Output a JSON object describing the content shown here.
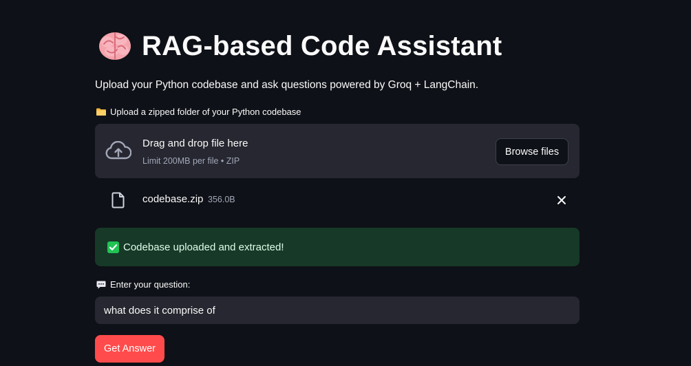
{
  "header": {
    "title": "RAG-based Code Assistant",
    "title_icon": "brain-icon",
    "subtitle": "Upload your Python codebase and ask questions powered by Groq + LangChain."
  },
  "uploader": {
    "label_icon": "folder-icon",
    "label": "Upload a zipped folder of your Python codebase",
    "drop_title": "Drag and drop file here",
    "drop_subtitle": "Limit 200MB per file • ZIP",
    "browse_label": "Browse files"
  },
  "uploaded_file": {
    "name": "codebase.zip",
    "size": "356.0B"
  },
  "status": {
    "icon": "check-icon",
    "message": "Codebase uploaded and extracted!"
  },
  "question": {
    "label_icon": "speech-balloon-icon",
    "label": "Enter your question:",
    "value": "what does it comprise of"
  },
  "actions": {
    "submit_label": "Get Answer"
  },
  "colors": {
    "background": "#0e1117",
    "surface": "#262730",
    "primary": "#ff4b4b",
    "success_bg": "#173928",
    "muted_text": "#a3a8b8"
  }
}
